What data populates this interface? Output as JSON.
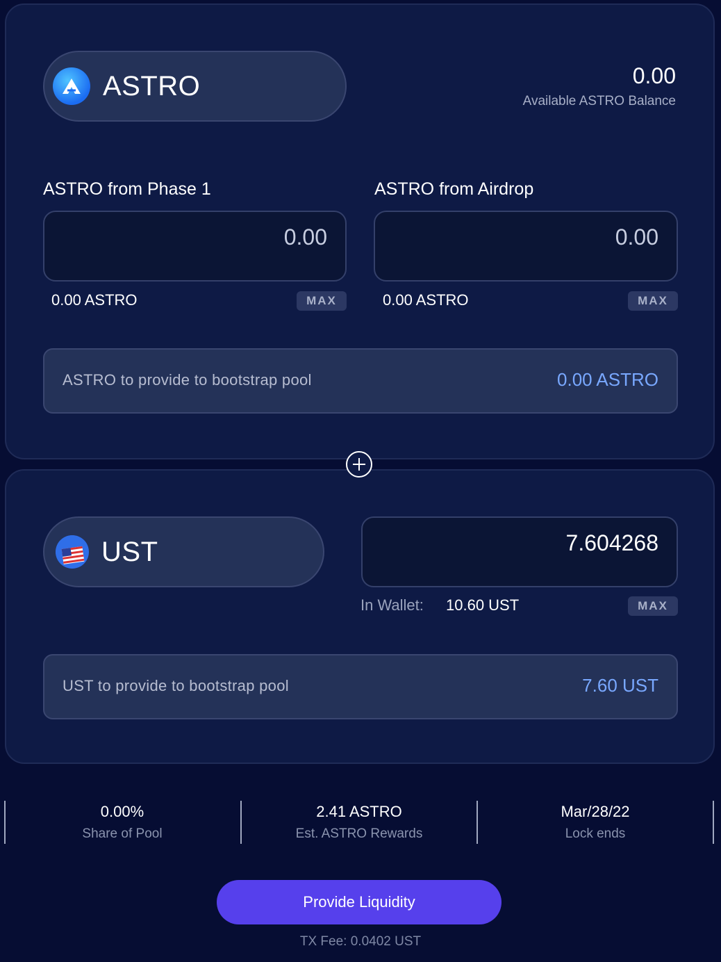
{
  "astro_section": {
    "token_name": "ASTRO",
    "token_icon": "astroport-logo-icon",
    "balance_value": "0.00",
    "balance_label": "Available ASTRO Balance",
    "phase1": {
      "label": "ASTRO from Phase 1",
      "amount": "0.00",
      "available": "0.00 ASTRO",
      "max_label": "MAX"
    },
    "airdrop": {
      "label": "ASTRO from Airdrop",
      "amount": "0.00",
      "available": "0.00 ASTRO",
      "max_label": "MAX"
    },
    "summary": {
      "label": "ASTRO to provide to bootstrap pool",
      "value": "0.00 ASTRO"
    }
  },
  "ust_section": {
    "token_name": "UST",
    "token_icon": "ust-flag-icon",
    "amount": "7.604268",
    "wallet_label": "In Wallet:",
    "wallet_value": "10.60 UST",
    "max_label": "MAX",
    "summary": {
      "label": "UST to provide to bootstrap pool",
      "value": "7.60 UST"
    }
  },
  "stats": [
    {
      "value": "0.00%",
      "label": "Share of Pool"
    },
    {
      "value": "2.41 ASTRO",
      "label": "Est. ASTRO Rewards"
    },
    {
      "value": "Mar/28/22",
      "label": "Lock ends"
    }
  ],
  "action": {
    "button_label": "Provide Liquidity",
    "tx_fee": "TX Fee: 0.0402 UST"
  },
  "colors": {
    "background": "#060d33",
    "card": "#0e1a45",
    "accent_button": "#5640ec",
    "highlight_value": "#79a8ff"
  }
}
